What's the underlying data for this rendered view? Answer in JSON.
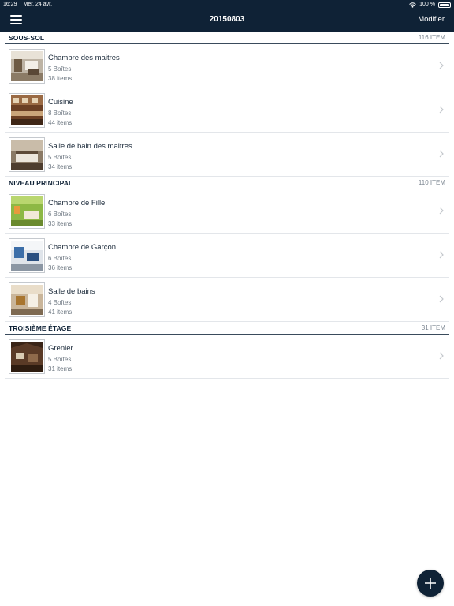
{
  "status_bar": {
    "time": "16:29",
    "date": "Mer. 24 avr.",
    "battery": "100 %"
  },
  "nav": {
    "title": "20150803",
    "edit_label": "Modifier"
  },
  "sections": [
    {
      "title": "SOUS-SOL",
      "count": "116 ITEM",
      "rows": [
        {
          "title": "Chambre des maitres",
          "boxes": "5 Boîtes",
          "items": "38 items"
        },
        {
          "title": "Cuisine",
          "boxes": "8 Boîtes",
          "items": "44 items"
        },
        {
          "title": "Salle de bain des maitres",
          "boxes": "5 Boîtes",
          "items": "34 items"
        }
      ]
    },
    {
      "title": "NIVEAU PRINCIPAL",
      "count": "110 ITEM",
      "rows": [
        {
          "title": "Chambre de Fille",
          "boxes": "6 Boîtes",
          "items": "33 items"
        },
        {
          "title": "Chambre de Garçon",
          "boxes": "6 Boîtes",
          "items": "36 items"
        },
        {
          "title": "Salle de bains",
          "boxes": "4 Boîtes",
          "items": "41 items"
        }
      ]
    },
    {
      "title": "TROISIÈME ÉTAGE",
      "count": "31 ITEM",
      "rows": [
        {
          "title": "Grenier",
          "boxes": "5 Boîtes",
          "items": "31 items"
        }
      ]
    }
  ],
  "colors": {
    "navy": "#0f2236",
    "divider": "#e3e6ea",
    "subtext": "#6f7983"
  }
}
